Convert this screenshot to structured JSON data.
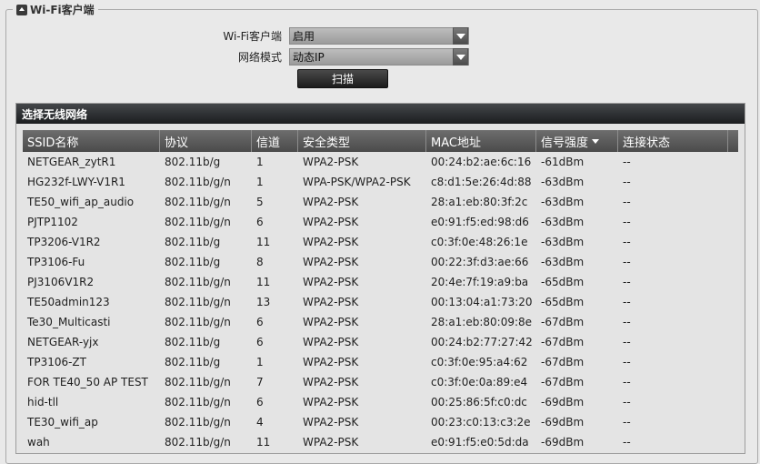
{
  "group": {
    "title": "Wi-Fi客户端"
  },
  "form": {
    "client_label": "Wi-Fi客户端",
    "client_value": "启用",
    "mode_label": "网络模式",
    "mode_value": "动态IP",
    "scan_label": "扫描"
  },
  "panel": {
    "title": "选择无线网络",
    "columns": [
      "SSID名称",
      "协议",
      "信道",
      "安全类型",
      "MAC地址",
      "信号强度",
      "连接状态"
    ],
    "rows": [
      {
        "ssid": "NETGEAR_zytR1",
        "protocol": "802.11b/g",
        "channel": "1",
        "security": "WPA2-PSK",
        "mac": "00:24:b2:ae:6c:16",
        "signal": "-61dBm",
        "status": "--"
      },
      {
        "ssid": "HG232f-LWY-V1R1",
        "protocol": "802.11b/g/n",
        "channel": "1",
        "security": "WPA-PSK/WPA2-PSK",
        "mac": "c8:d1:5e:26:4d:88",
        "signal": "-63dBm",
        "status": "--"
      },
      {
        "ssid": "TE50_wifi_ap_audio",
        "protocol": "802.11b/g/n",
        "channel": "5",
        "security": "WPA2-PSK",
        "mac": "28:a1:eb:80:3f:2c",
        "signal": "-63dBm",
        "status": "--"
      },
      {
        "ssid": "PJTP1102",
        "protocol": "802.11b/g/n",
        "channel": "6",
        "security": "WPA2-PSK",
        "mac": "e0:91:f5:ed:98:d6",
        "signal": "-63dBm",
        "status": "--"
      },
      {
        "ssid": "TP3206-V1R2",
        "protocol": "802.11b/g",
        "channel": "11",
        "security": "WPA2-PSK",
        "mac": "c0:3f:0e:48:26:1e",
        "signal": "-63dBm",
        "status": "--"
      },
      {
        "ssid": "TP3106-Fu",
        "protocol": "802.11b/g",
        "channel": "8",
        "security": "WPA2-PSK",
        "mac": "00:22:3f:d3:ae:66",
        "signal": "-63dBm",
        "status": "--"
      },
      {
        "ssid": "PJ3106V1R2",
        "protocol": "802.11b/g/n",
        "channel": "11",
        "security": "WPA2-PSK",
        "mac": "20:4e:7f:19:a9:ba",
        "signal": "-65dBm",
        "status": "--"
      },
      {
        "ssid": "TE50admin123",
        "protocol": "802.11b/g/n",
        "channel": "13",
        "security": "WPA2-PSK",
        "mac": "00:13:04:a1:73:20",
        "signal": "-65dBm",
        "status": "--"
      },
      {
        "ssid": "Te30_Multicasti",
        "protocol": "802.11b/g/n",
        "channel": "6",
        "security": "WPA2-PSK",
        "mac": "28:a1:eb:80:09:8e",
        "signal": "-67dBm",
        "status": "--"
      },
      {
        "ssid": "NETGEAR-yjx",
        "protocol": "802.11b/g",
        "channel": "6",
        "security": "WPA2-PSK",
        "mac": "00:24:b2:77:27:42",
        "signal": "-67dBm",
        "status": "--"
      },
      {
        "ssid": "TP3106-ZT",
        "protocol": "802.11b/g",
        "channel": "1",
        "security": "WPA2-PSK",
        "mac": "c0:3f:0e:95:a4:62",
        "signal": "-67dBm",
        "status": "--"
      },
      {
        "ssid": "FOR TE40_50 AP TEST",
        "protocol": "802.11b/g/n",
        "channel": "7",
        "security": "WPA2-PSK",
        "mac": "c0:3f:0e:0a:89:e4",
        "signal": "-67dBm",
        "status": "--"
      },
      {
        "ssid": "hid-tll",
        "protocol": "802.11b/g/n",
        "channel": "6",
        "security": "WPA2-PSK",
        "mac": "00:25:86:5f:c0:dc",
        "signal": "-69dBm",
        "status": "--"
      },
      {
        "ssid": "TE30_wifi_ap",
        "protocol": "802.11b/g/n",
        "channel": "4",
        "security": "WPA2-PSK",
        "mac": "00:23:c0:13:c3:2e",
        "signal": "-69dBm",
        "status": "--"
      },
      {
        "ssid": "wah",
        "protocol": "802.11b/g/n",
        "channel": "11",
        "security": "WPA2-PSK",
        "mac": "e0:91:f5:e0:5d:da",
        "signal": "-69dBm",
        "status": "--"
      }
    ]
  }
}
